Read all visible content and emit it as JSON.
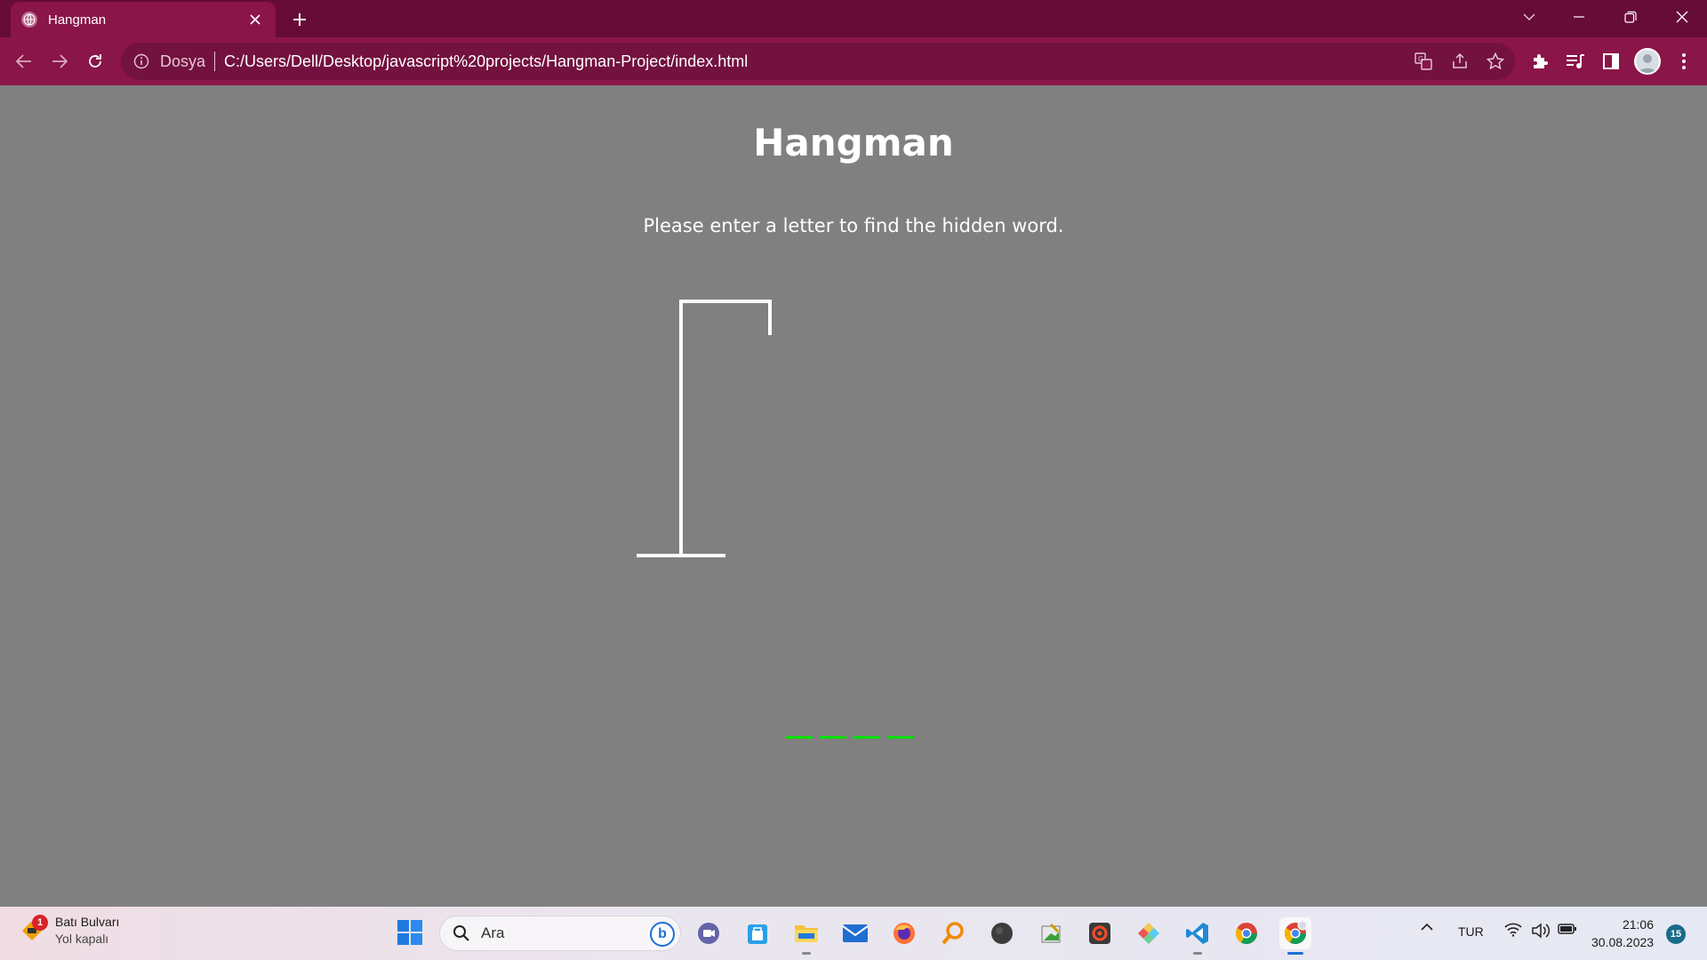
{
  "browser": {
    "tab_title": "Hangman",
    "address_scheme_label": "Dosya",
    "address_url": "C:/Users/Dell/Desktop/javascript%20projects/Hangman-Project/index.html",
    "accent_color": "#8a1548",
    "tabbar_color": "#670b37"
  },
  "game": {
    "title": "Hangman",
    "instruction": "Please enter a letter to find the hidden word.",
    "hidden_word_length": 4,
    "wrong_guesses": 0,
    "blank_color": "#00e000"
  },
  "taskbar": {
    "weather_title": "Batı Bulvarı",
    "weather_subtitle": "Yol kapalı",
    "weather_badge": "1",
    "search_placeholder": "Ara",
    "language": "TUR",
    "time": "21:06",
    "date": "30.08.2023",
    "notification_count": "15",
    "pinned_apps": [
      "start-icon",
      "teams-icon",
      "store-icon",
      "file-explorer-icon",
      "mail-icon",
      "firefox-icon",
      "search-app-icon",
      "obs-icon",
      "notepad-icon",
      "recorder-icon",
      "pen-icon",
      "vscode-icon",
      "chrome-icon",
      "chrome-profile-icon"
    ]
  }
}
